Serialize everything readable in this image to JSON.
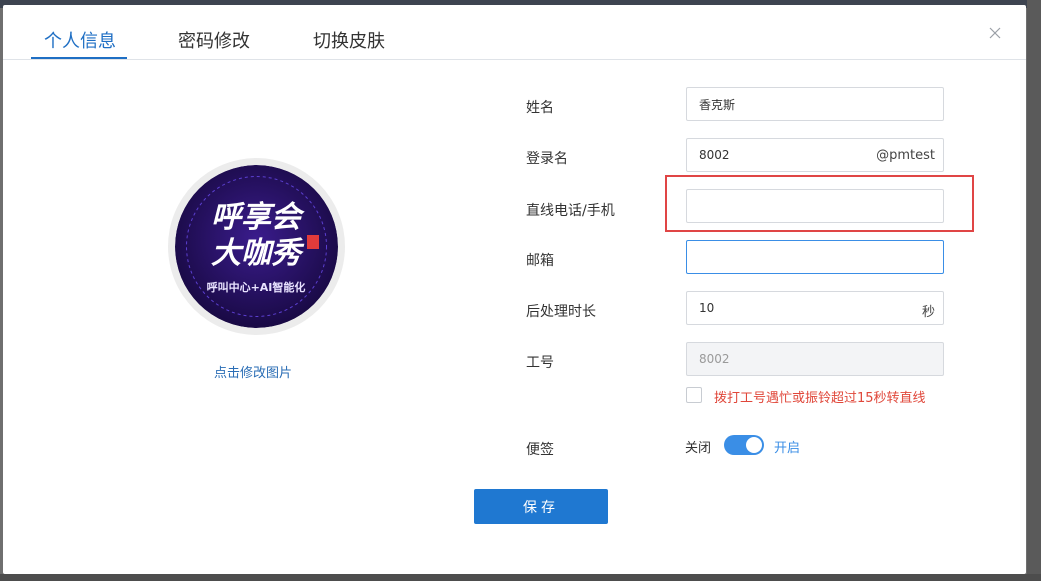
{
  "tabs": [
    {
      "label": "个人信息",
      "active": true
    },
    {
      "label": "密码修改",
      "active": false
    },
    {
      "label": "切换皮肤",
      "active": false
    }
  ],
  "avatar": {
    "change_label": "点击修改图片",
    "art_line1": "呼享会",
    "art_line2": "大咖秀",
    "art_subtitle": "呼叫中心+AI智能化"
  },
  "form": {
    "name": {
      "label": "姓名",
      "value": "香克斯"
    },
    "login": {
      "label": "登录名",
      "value": "8002",
      "suffix": "@pmtest"
    },
    "phone": {
      "label": "直线电话/手机",
      "value": ""
    },
    "email": {
      "label": "邮箱",
      "value": ""
    },
    "after_call": {
      "label": "后处理时长",
      "value": "10",
      "suffix": "秒"
    },
    "work_no": {
      "label": "工号",
      "value": "8002"
    },
    "forward_checkbox": {
      "label": "拨打工号遇忙或振铃超过15秒转直线",
      "checked": false
    },
    "sticky_note": {
      "label": "便签",
      "off_label": "关闭",
      "on_label": "开启",
      "enabled": true
    }
  },
  "actions": {
    "save_label": "保存"
  },
  "colors": {
    "accent": "#1f78d1",
    "tab_active": "#1f6fc4",
    "warning_text": "#e0473a",
    "highlight_border": "#e04545"
  },
  "icons": {
    "close": "close-icon"
  }
}
